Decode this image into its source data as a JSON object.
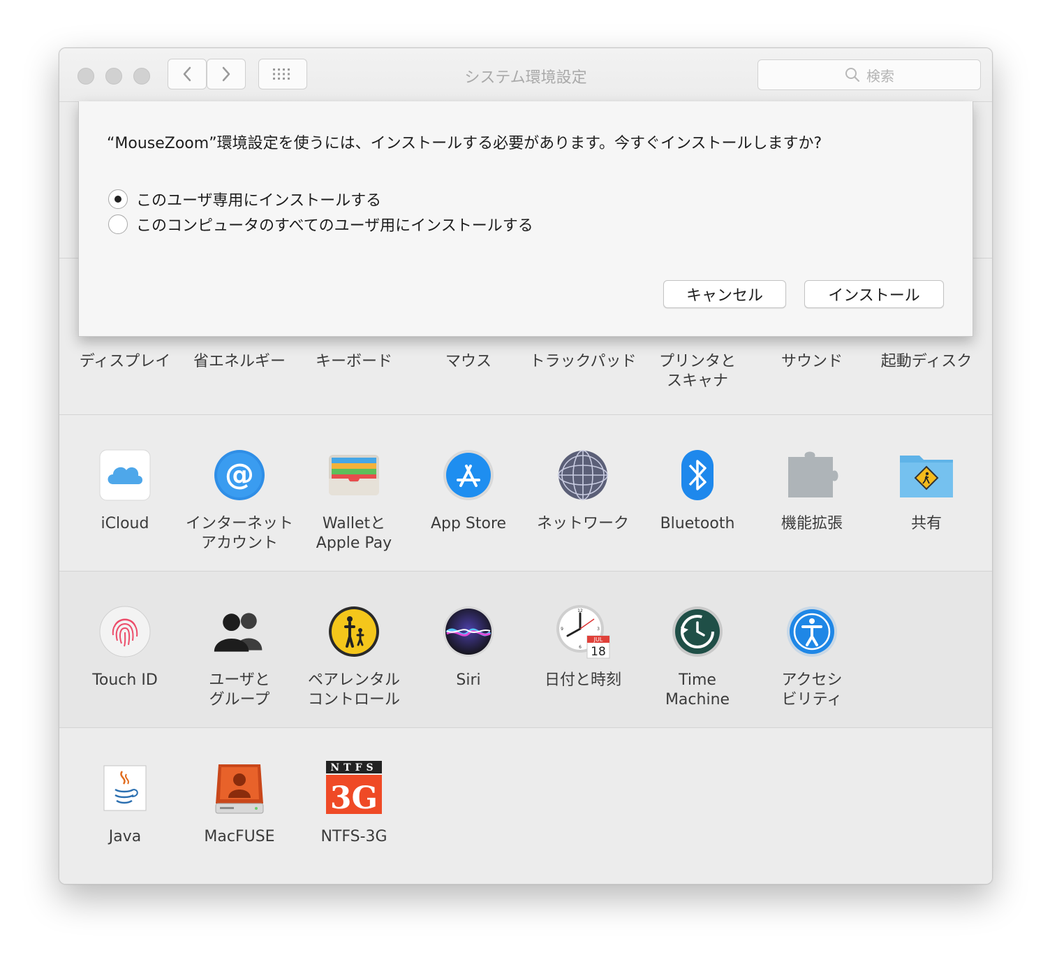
{
  "window": {
    "title": "システム環境設定"
  },
  "search": {
    "placeholder": "検索"
  },
  "dialog": {
    "message": "“MouseZoom”環境設定を使うには、インストールする必要があります。今すぐインストールしますか?",
    "options": [
      {
        "label": "このユーザ専用にインストールする",
        "selected": true
      },
      {
        "label": "このコンピュータのすべてのユーザ用にインストールする",
        "selected": false
      }
    ],
    "cancel_label": "キャンセル",
    "install_label": "インストール"
  },
  "rows": {
    "hardware": [
      "ディスプレイ",
      "省エネルギー",
      "キーボード",
      "マウス",
      "トラックパッド",
      "プリンタと\nスキャナ",
      "サウンド",
      "起動ディスク"
    ],
    "internet": [
      "iCloud",
      "インターネット\nアカウント",
      "Walletと\nApple Pay",
      "App Store",
      "ネットワーク",
      "Bluetooth",
      "機能拡張",
      "共有"
    ],
    "system": [
      "Touch ID",
      "ユーザと\nグループ",
      "ペアレンタル\nコントロール",
      "Siri",
      "日付と時刻",
      "Time\nMachine",
      "アクセシ\nビリティ"
    ],
    "other": [
      "Java",
      "MacFUSE",
      "NTFS-3G"
    ]
  },
  "icons": {
    "internet": [
      "icloud-icon",
      "internet-accounts-icon",
      "wallet-icon",
      "app-store-icon",
      "network-globe-icon",
      "bluetooth-icon",
      "extensions-puzzle-icon",
      "sharing-folder-icon"
    ],
    "system": [
      "touch-id-fingerprint-icon",
      "users-groups-icon",
      "parental-controls-icon",
      "siri-icon",
      "date-time-clock-icon",
      "time-machine-icon",
      "accessibility-icon"
    ],
    "other": [
      "java-icon",
      "macfuse-drive-icon",
      "ntfs-3g-icon"
    ]
  },
  "clock_calendar": {
    "month": "JUL",
    "day": "18"
  },
  "ntfs_badge": {
    "top": "NTFS",
    "main": "3G"
  }
}
